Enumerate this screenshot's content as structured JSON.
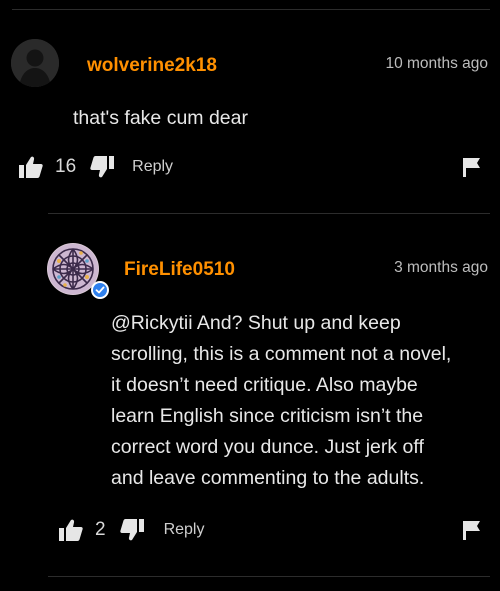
{
  "comments": [
    {
      "username": "wolverine2k18",
      "time": "10 months ago",
      "text": "that's fake cum dear",
      "likes": "16",
      "reply_label": "Reply",
      "avatar": "default-user-avatar"
    },
    {
      "username": "FireLife0510",
      "time": "3 months ago",
      "text_lines": [
        "@Rickytii And? Shut up and keep",
        "scrolling, this is a comment not a novel,",
        "it doesn’t need critique. Also maybe",
        "learn English since criticism isn’t the",
        "correct word you dunce. Just jerk off",
        "and leave commenting to the adults."
      ],
      "likes": "2",
      "reply_label": "Reply",
      "avatar": "mandala-avatar",
      "verified": true
    }
  ],
  "icons": {
    "like": "thumbs-up-icon",
    "dislike": "thumbs-down-icon",
    "flag": "flag-icon",
    "verified": "verified-check-icon"
  },
  "colors": {
    "background": "#000000",
    "username": "#ff9000",
    "verified": "#2f80ed",
    "divider": "#2c2c2c"
  }
}
